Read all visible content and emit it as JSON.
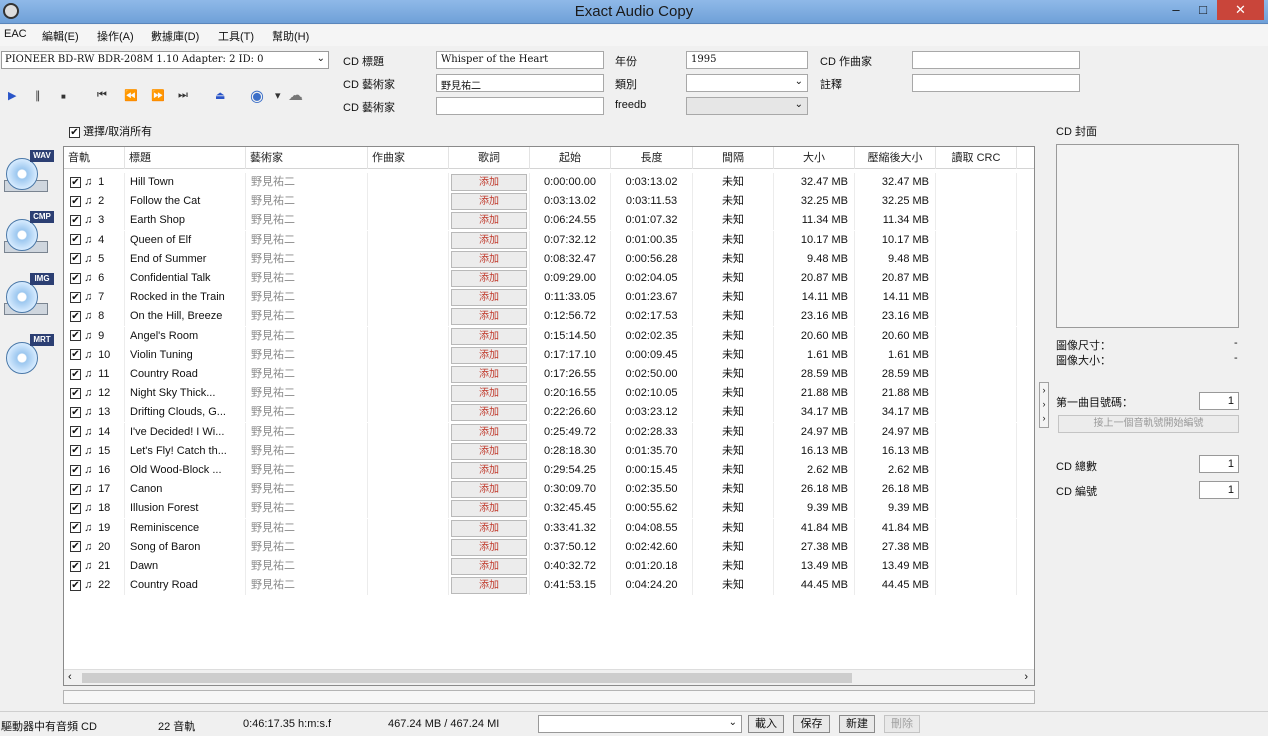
{
  "window": {
    "title": "Exact Audio Copy",
    "min": "‒",
    "max": "□",
    "close": "✕"
  },
  "menu": [
    "EAC",
    "編輯(E)",
    "操作(A)",
    "數據庫(D)",
    "工具(T)",
    "幫助(H)"
  ],
  "drive": {
    "value": "PIONEER BD-RW   BDR-208M 1.10   Adapter: 2  ID: 0"
  },
  "toolbar": {
    "play": "▶",
    "pause": "∥",
    "stop": "■",
    "first": "⏮",
    "prev": "⏪",
    "next": "⏩",
    "last": "⏭",
    "eject": "⏏",
    "refresh": "◉",
    "more": "▾",
    "net": "☁"
  },
  "meta": {
    "cd_title_label": "CD 標題",
    "cd_title": "Whisper of the Heart",
    "cd_artist_label": "CD 藝術家",
    "cd_artist": "野見祐二",
    "cd_artist2_label": "CD 藝術家",
    "cd_artist2": "",
    "year_label": "年份",
    "year": "1995",
    "genre_label": "類別",
    "genre": "",
    "freedb_label": "freedb",
    "freedb": "",
    "composer_label": "CD 作曲家",
    "composer": "",
    "comment_label": "註釋",
    "comment": ""
  },
  "media_icons": [
    {
      "name": "wav",
      "label": "WAV"
    },
    {
      "name": "cmp",
      "label": "CMP"
    },
    {
      "name": "img",
      "label": "IMG"
    },
    {
      "name": "mrt",
      "label": "MRT"
    }
  ],
  "select_all": {
    "label": "選擇/取消所有",
    "check": "✔"
  },
  "columns": [
    "音軌",
    "標題",
    "藝術家",
    "作曲家",
    "歌詞",
    "起始",
    "長度",
    "間隔",
    "大小",
    "壓縮後大小",
    "讀取 CRC"
  ],
  "lyrics_btn": "添加",
  "tracks": [
    {
      "n": "1",
      "title": "Hill Town",
      "artist": "野見祐二",
      "start": "0:00:00.00",
      "len": "0:03:13.02",
      "gap": "未知",
      "size": "32.47 MB",
      "csize": "32.47 MB"
    },
    {
      "n": "2",
      "title": "Follow the Cat",
      "artist": "野見祐二",
      "start": "0:03:13.02",
      "len": "0:03:11.53",
      "gap": "未知",
      "size": "32.25 MB",
      "csize": "32.25 MB"
    },
    {
      "n": "3",
      "title": "Earth Shop",
      "artist": "野見祐二",
      "start": "0:06:24.55",
      "len": "0:01:07.32",
      "gap": "未知",
      "size": "11.34 MB",
      "csize": "11.34 MB"
    },
    {
      "n": "4",
      "title": "Queen of Elf",
      "artist": "野見祐二",
      "start": "0:07:32.12",
      "len": "0:01:00.35",
      "gap": "未知",
      "size": "10.17 MB",
      "csize": "10.17 MB"
    },
    {
      "n": "5",
      "title": "End of Summer",
      "artist": "野見祐二",
      "start": "0:08:32.47",
      "len": "0:00:56.28",
      "gap": "未知",
      "size": "9.48 MB",
      "csize": "9.48 MB"
    },
    {
      "n": "6",
      "title": "Confidential Talk",
      "artist": "野見祐二",
      "start": "0:09:29.00",
      "len": "0:02:04.05",
      "gap": "未知",
      "size": "20.87 MB",
      "csize": "20.87 MB"
    },
    {
      "n": "7",
      "title": "Rocked in the Train",
      "artist": "野見祐二",
      "start": "0:11:33.05",
      "len": "0:01:23.67",
      "gap": "未知",
      "size": "14.11 MB",
      "csize": "14.11 MB"
    },
    {
      "n": "8",
      "title": "On the Hill, Breeze",
      "artist": "野見祐二",
      "start": "0:12:56.72",
      "len": "0:02:17.53",
      "gap": "未知",
      "size": "23.16 MB",
      "csize": "23.16 MB"
    },
    {
      "n": "9",
      "title": "Angel's Room",
      "artist": "野見祐二",
      "start": "0:15:14.50",
      "len": "0:02:02.35",
      "gap": "未知",
      "size": "20.60 MB",
      "csize": "20.60 MB"
    },
    {
      "n": "10",
      "title": "Violin Tuning",
      "artist": "野見祐二",
      "start": "0:17:17.10",
      "len": "0:00:09.45",
      "gap": "未知",
      "size": "1.61 MB",
      "csize": "1.61 MB"
    },
    {
      "n": "11",
      "title": "Country Road",
      "artist": "野見祐二",
      "start": "0:17:26.55",
      "len": "0:02:50.00",
      "gap": "未知",
      "size": "28.59 MB",
      "csize": "28.59 MB"
    },
    {
      "n": "12",
      "title": "Night Sky Thick...",
      "artist": "野見祐二",
      "start": "0:20:16.55",
      "len": "0:02:10.05",
      "gap": "未知",
      "size": "21.88 MB",
      "csize": "21.88 MB"
    },
    {
      "n": "13",
      "title": "Drifting Clouds, G...",
      "artist": "野見祐二",
      "start": "0:22:26.60",
      "len": "0:03:23.12",
      "gap": "未知",
      "size": "34.17 MB",
      "csize": "34.17 MB"
    },
    {
      "n": "14",
      "title": "I've Decided! I Wi...",
      "artist": "野見祐二",
      "start": "0:25:49.72",
      "len": "0:02:28.33",
      "gap": "未知",
      "size": "24.97 MB",
      "csize": "24.97 MB"
    },
    {
      "n": "15",
      "title": "Let's Fly! Catch th...",
      "artist": "野見祐二",
      "start": "0:28:18.30",
      "len": "0:01:35.70",
      "gap": "未知",
      "size": "16.13 MB",
      "csize": "16.13 MB"
    },
    {
      "n": "16",
      "title": "Old Wood-Block ...",
      "artist": "野見祐二",
      "start": "0:29:54.25",
      "len": "0:00:15.45",
      "gap": "未知",
      "size": "2.62 MB",
      "csize": "2.62 MB"
    },
    {
      "n": "17",
      "title": "Canon",
      "artist": "野見祐二",
      "start": "0:30:09.70",
      "len": "0:02:35.50",
      "gap": "未知",
      "size": "26.18 MB",
      "csize": "26.18 MB"
    },
    {
      "n": "18",
      "title": "Illusion Forest",
      "artist": "野見祐二",
      "start": "0:32:45.45",
      "len": "0:00:55.62",
      "gap": "未知",
      "size": "9.39 MB",
      "csize": "9.39 MB"
    },
    {
      "n": "19",
      "title": "Reminiscence",
      "artist": "野見祐二",
      "start": "0:33:41.32",
      "len": "0:04:08.55",
      "gap": "未知",
      "size": "41.84 MB",
      "csize": "41.84 MB"
    },
    {
      "n": "20",
      "title": "Song of Baron",
      "artist": "野見祐二",
      "start": "0:37:50.12",
      "len": "0:02:42.60",
      "gap": "未知",
      "size": "27.38 MB",
      "csize": "27.38 MB"
    },
    {
      "n": "21",
      "title": "Dawn",
      "artist": "野見祐二",
      "start": "0:40:32.72",
      "len": "0:01:20.18",
      "gap": "未知",
      "size": "13.49 MB",
      "csize": "13.49 MB"
    },
    {
      "n": "22",
      "title": "Country Road",
      "artist": "野見祐二",
      "start": "0:41:53.15",
      "len": "0:04:24.20",
      "gap": "未知",
      "size": "44.45 MB",
      "csize": "44.45 MB"
    }
  ],
  "right": {
    "cover_label": "CD 封面",
    "image_dim_label": "圖像尺寸：",
    "image_dim_val": "-",
    "image_size_label": "圖像大小：",
    "image_size_val": "-",
    "first_track_label": "第一曲目號碼：",
    "first_track": "1",
    "continue_btn": "接上一個音軌號開始編號",
    "cd_count_label": "CD 總數",
    "cd_count": "1",
    "cd_num_label": "CD 編號",
    "cd_num": "1",
    "expander": "›"
  },
  "status": {
    "drive_msg": "驅動器中有音頻 CD",
    "tracks": "22 音軌",
    "duration": "0:46:17.35 h:m:s.f",
    "size": "467.24 MB / 467.24 MI",
    "load": "載入",
    "save": "保存",
    "new": "新建",
    "delete": "刪除"
  },
  "arrows": {
    "dd": "⌄",
    "left": "‹",
    "right": "›"
  }
}
